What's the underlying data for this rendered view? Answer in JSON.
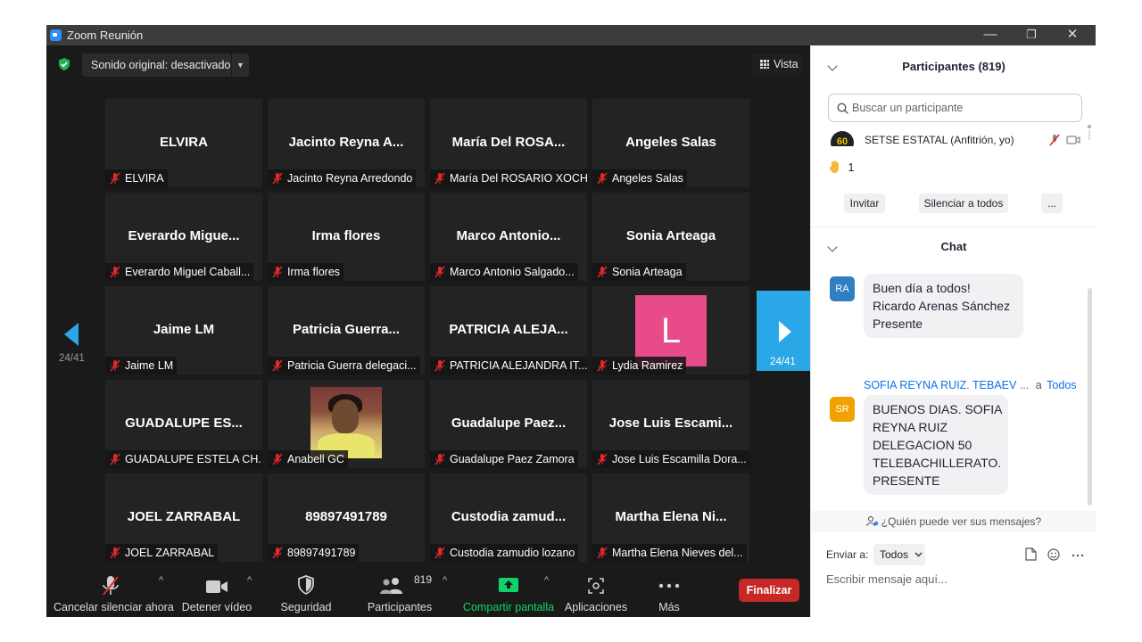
{
  "window": {
    "title": "Zoom Reunión",
    "minimize": "—",
    "restore": "❐",
    "close": "✕"
  },
  "topbar": {
    "sound_label": "Sonido original: desactivado",
    "sound_caret": "▼",
    "view_label": "Vista"
  },
  "gallery": {
    "page_indicator": "24/41",
    "tiles": [
      {
        "big": "ELVIRA",
        "label": "ELVIRA"
      },
      {
        "big": "Jacinto Reyna A...",
        "label": "Jacinto Reyna Arredondo"
      },
      {
        "big": "María Del ROSA...",
        "label": "María Del ROSARIO XOCHI..."
      },
      {
        "big": "Angeles Salas",
        "label": "Angeles Salas"
      },
      {
        "big": "Everardo Migue...",
        "label": "Everardo Miguel Caball..."
      },
      {
        "big": "Irma flores",
        "label": "Irma flores"
      },
      {
        "big": "Marco Antonio...",
        "label": "Marco Antonio Salgado..."
      },
      {
        "big": "Sonia Arteaga",
        "label": "Sonia Arteaga"
      },
      {
        "big": "Jaime LM",
        "label": "Jaime LM"
      },
      {
        "big": "Patricia Guerra...",
        "label": "Patricia Guerra delegaci..."
      },
      {
        "big": "PATRICIA ALEJA...",
        "label": "PATRICIA ALEJANDRA IT..."
      },
      {
        "big": "",
        "label": "Lydia Ramirez",
        "letter": "L"
      },
      {
        "big": "GUADALUPE ES...",
        "label": "GUADALUPE ESTELA CH..."
      },
      {
        "big": "",
        "label": "Anabell GC",
        "photo": true
      },
      {
        "big": "Guadalupe Paez...",
        "label": "Guadalupe Paez Zamora"
      },
      {
        "big": "Jose Luis Escami...",
        "label": "Jose Luis Escamilla Dora..."
      },
      {
        "big": "JOEL ZARRABAL",
        "label": "JOEL ZARRABAL"
      },
      {
        "big": "89897491789",
        "label": "89897491789"
      },
      {
        "big": "Custodia zamud...",
        "label": "Custodia zamudio lozano"
      },
      {
        "big": "Martha Elena Ni...",
        "label": "Martha Elena Nieves del..."
      }
    ]
  },
  "toolbar": {
    "unmute": "Cancelar silenciar ahora",
    "video": "Detener vídeo",
    "security": "Seguridad",
    "participants": "Participantes",
    "participants_count": "819",
    "share": "Compartir pantalla",
    "apps": "Aplicaciones",
    "more": "Más",
    "end": "Finalizar",
    "caret": "^"
  },
  "participants_panel": {
    "title": "Participantes (819)",
    "search_placeholder": "Buscar un participante",
    "host_avatar": "60",
    "host_name": "SETSE ESTATAL (Anfitrión, yo)",
    "hand_count": "1",
    "invite": "Invitar",
    "mute_all": "Silenciar a todos",
    "more": "..."
  },
  "chat": {
    "title": "Chat",
    "messages": [
      {
        "initials": "RA",
        "lines": [
          "Buen día a todos!",
          "Ricardo Arenas Sánchez",
          "Presente"
        ]
      },
      {
        "initials": "SR",
        "sender": "SOFIA  REYNA  RUIZ. TEBAEV ...",
        "to": "a",
        "to_target": "Todos",
        "lines": [
          "BUENOS DIAS. SOFIA",
          "REYNA RUIZ",
          "DELEGACION  50",
          "TELEBACHILLERATO.",
          "PRESENTE"
        ]
      }
    ],
    "who_sees": "¿Quién puede ver sus mensajes?",
    "send_to_label": "Enviar a:",
    "send_to_value": "Todos",
    "compose_placeholder": "Escribir mensaje aquí..."
  },
  "colors": {
    "accent": "#2aa7e6",
    "end": "#c62828",
    "share": "#0fd36a",
    "link": "#0e71eb",
    "avatar_ra": "#2f7fc1",
    "avatar_sr": "#f2a200",
    "letter_avatar": "#e84c88"
  }
}
